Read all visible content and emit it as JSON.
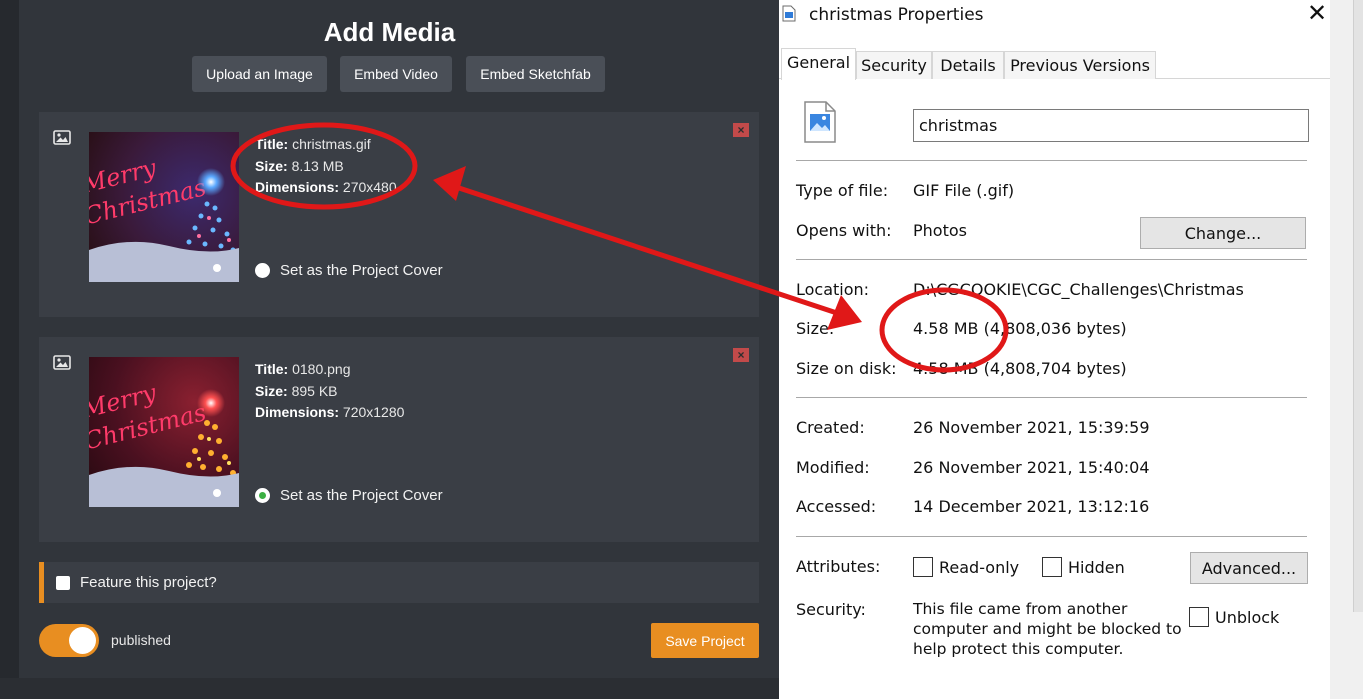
{
  "add_media": {
    "title": "Add Media",
    "buttons": [
      "Upload an Image",
      "Embed Video",
      "Embed Sketchfab"
    ],
    "items": [
      {
        "title_label": "Title:",
        "title": "christmas.gif",
        "size_label": "Size:",
        "size": "8.13 MB",
        "dims_label": "Dimensions:",
        "dims": "270x480",
        "cover_label": "Set as the Project Cover",
        "cover_selected": false,
        "close": "×"
      },
      {
        "title_label": "Title:",
        "title": "0180.png",
        "size_label": "Size:",
        "size": "895 KB",
        "dims_label": "Dimensions:",
        "dims": "720x1280",
        "cover_label": "Set as the Project Cover",
        "cover_selected": true,
        "close": "×"
      }
    ],
    "feature_label": "Feature this project?",
    "published_label": "published",
    "save_label": "Save Project",
    "accent": "#e88e21"
  },
  "dialog": {
    "title": "christmas Properties",
    "close": "✕",
    "tabs": [
      "General",
      "Security",
      "Details",
      "Previous Versions"
    ],
    "file_name": "christmas",
    "type_label": "Type of file:",
    "type_value": "GIF File (.gif)",
    "opens_label": "Opens with:",
    "opens_value": "Photos",
    "change_label": "Change...",
    "location_label": "Location:",
    "location_value": "D:\\CGCOOKIE\\CGC_Challenges\\Christmas",
    "size_label": "Size:",
    "size_value": "4.58 MB (4,808,036 bytes)",
    "disk_label": "Size on disk:",
    "disk_value": "4.58 MB (4,808,704 bytes)",
    "created_label": "Created:",
    "created_value": "26 November 2021, 15:39:59",
    "modified_label": "Modified:",
    "modified_value": "26 November 2021, 15:40:04",
    "accessed_label": "Accessed:",
    "accessed_value": "14 December 2021, 13:12:16",
    "attributes_label": "Attributes:",
    "readonly_label": "Read-only",
    "hidden_label": "Hidden",
    "advanced_label": "Advanced...",
    "security_label": "Security:",
    "security_text": "This file came from another computer and might be blocked to help protect this computer.",
    "unblock_label": "Unblock"
  },
  "annotation_color": "#e01818"
}
